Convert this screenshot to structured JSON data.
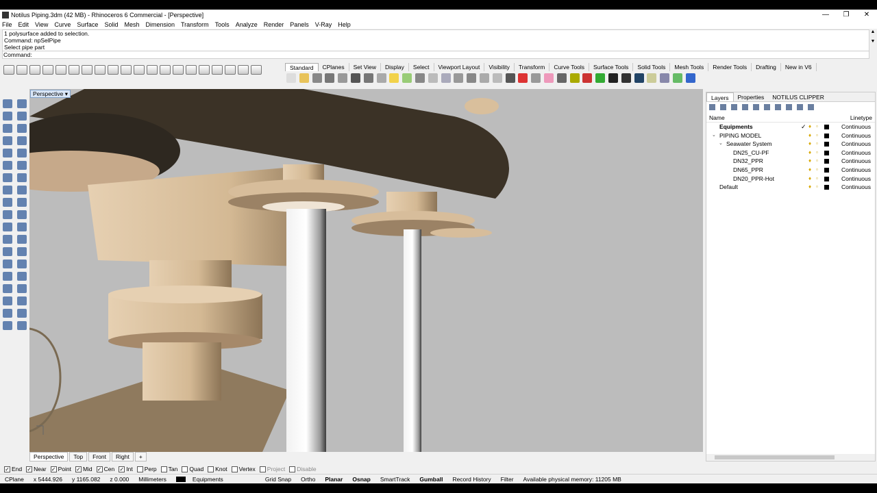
{
  "window": {
    "title": "Notilus Piping.3dm (42 MB) - Rhinoceros 6 Commercial - [Perspective]"
  },
  "menu": [
    "File",
    "Edit",
    "View",
    "Curve",
    "Surface",
    "Solid",
    "Mesh",
    "Dimension",
    "Transform",
    "Tools",
    "Analyze",
    "Render",
    "Panels",
    "V-Ray",
    "Help"
  ],
  "command": {
    "history": [
      "1 polysurface added to selection.",
      "Command: npSelPipe",
      "Select pipe part"
    ],
    "prompt": "Command:"
  },
  "toolbar_tabs": [
    "Standard",
    "CPlanes",
    "Set View",
    "Display",
    "Select",
    "Viewport Layout",
    "Visibility",
    "Transform",
    "Curve Tools",
    "Surface Tools",
    "Solid Tools",
    "Mesh Tools",
    "Render Tools",
    "Drafting",
    "New in V6"
  ],
  "viewport": {
    "label": "Perspective"
  },
  "viewport_tabs": [
    "Perspective",
    "Top",
    "Front",
    "Right",
    "+"
  ],
  "panel": {
    "tabs": [
      "Layers",
      "Properties",
      "NOTILUS CLIPPER"
    ],
    "col_name": "Name",
    "col_linetype": "Linetype",
    "layers": [
      {
        "name": "Equipments",
        "linetype": "Continuous",
        "bold": true,
        "indent": 0,
        "current": true
      },
      {
        "name": "PIPING MODEL",
        "linetype": "Continuous",
        "indent": 0,
        "expanded": true
      },
      {
        "name": "Seawater System",
        "linetype": "Continuous",
        "indent": 1,
        "expanded": true
      },
      {
        "name": "DN25_CU-PF",
        "linetype": "Continuous",
        "indent": 2
      },
      {
        "name": "DN32_PPR",
        "linetype": "Continuous",
        "indent": 2
      },
      {
        "name": "DN65_PPR",
        "linetype": "Continuous",
        "indent": 2
      },
      {
        "name": "DN20_PPR-Hot",
        "linetype": "Continuous",
        "indent": 2
      },
      {
        "name": "Default",
        "linetype": "Continuous",
        "indent": 0
      }
    ]
  },
  "osnaps": [
    {
      "label": "End",
      "checked": true
    },
    {
      "label": "Near",
      "checked": true
    },
    {
      "label": "Point",
      "checked": true
    },
    {
      "label": "Mid",
      "checked": true
    },
    {
      "label": "Cen",
      "checked": true
    },
    {
      "label": "Int",
      "checked": true
    },
    {
      "label": "Perp",
      "checked": false
    },
    {
      "label": "Tan",
      "checked": false
    },
    {
      "label": "Quad",
      "checked": false
    },
    {
      "label": "Knot",
      "checked": false
    },
    {
      "label": "Vertex",
      "checked": false
    },
    {
      "label": "Project",
      "checked": false,
      "disabled": true
    },
    {
      "label": "Disable",
      "checked": false,
      "disabled": true
    }
  ],
  "status": {
    "cplane": "CPlane",
    "x": "x 5444.926",
    "y": "y 1165.082",
    "z": "z 0.000",
    "units": "Millimeters",
    "layer": "Equipments",
    "toggles": [
      {
        "label": "Grid Snap",
        "bold": false
      },
      {
        "label": "Ortho",
        "bold": false
      },
      {
        "label": "Planar",
        "bold": true
      },
      {
        "label": "Osnap",
        "bold": true
      },
      {
        "label": "SmartTrack",
        "bold": false
      },
      {
        "label": "Gumball",
        "bold": true
      },
      {
        "label": "Record History",
        "bold": false
      },
      {
        "label": "Filter",
        "bold": false
      }
    ],
    "memory": "Available physical memory: 11205 MB"
  },
  "colors": {
    "model": "#dcc3a2",
    "viewport_bg": "#bcbcbc",
    "accent": "#2b5797"
  }
}
